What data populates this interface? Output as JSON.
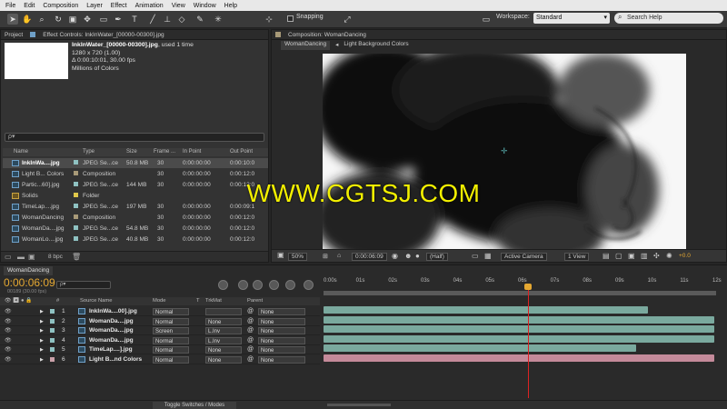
{
  "menu": [
    "File",
    "Edit",
    "Composition",
    "Layer",
    "Effect",
    "Animation",
    "View",
    "Window",
    "Help"
  ],
  "toolbar": {
    "snapping_label": "Snapping",
    "workspace_label": "Workspace:",
    "workspace_value": "Standard",
    "search_placeholder": "Search Help"
  },
  "project": {
    "tab_project": "Project",
    "tab_effect_controls": "Effect Controls: InkInWater_[00000-00300].jpg",
    "info_name": "InkInWater_[00000-00300].jpg",
    "info_used": ", used 1 time",
    "info_dims": "1280 x 720 (1.00)",
    "info_duration": "Δ 0:00:10:01, 30.00 fps",
    "info_colors": "Millions of Colors",
    "search_placeholder": "ρ▾",
    "columns": {
      "name": "Name",
      "type": "Type",
      "size": "Size",
      "frame_rate": "Frame ...",
      "in_point": "In Point",
      "out_point": "Out Point"
    },
    "items": [
      {
        "name": "InkInWa....jpg",
        "type": "JPEG Se...ce",
        "size": "50.8 MB",
        "fps": "30",
        "in": "0:00:00:00",
        "out": "0:00:10:0",
        "color": "#8fc2c2",
        "kind": "footage"
      },
      {
        "name": "Light B... Colors",
        "type": "Composition",
        "size": "",
        "fps": "30",
        "in": "0:00:00:00",
        "out": "0:00:12:0",
        "color": "#a89a78",
        "kind": "comp"
      },
      {
        "name": "Partic...60].jpg",
        "type": "JPEG Se...ce",
        "size": "144 MB",
        "fps": "30",
        "in": "0:00:00:00",
        "out": "0:00:12:0",
        "color": "#8fc2c2",
        "kind": "footage"
      },
      {
        "name": "Solids",
        "type": "Folder",
        "size": "",
        "fps": "",
        "in": "",
        "out": "",
        "color": "#e0c84a",
        "kind": "folder"
      },
      {
        "name": "TimeLap....jpg",
        "type": "JPEG Se...ce",
        "size": "197 MB",
        "fps": "30",
        "in": "0:00:00:00",
        "out": "0:00:09:1",
        "color": "#8fc2c2",
        "kind": "footage"
      },
      {
        "name": "WomanDancing",
        "type": "Composition",
        "size": "",
        "fps": "30",
        "in": "0:00:00:00",
        "out": "0:00:12:0",
        "color": "#a89a78",
        "kind": "comp"
      },
      {
        "name": "WomanDa....jpg",
        "type": "JPEG Se...ce",
        "size": "54.8 MB",
        "fps": "30",
        "in": "0:00:00:00",
        "out": "0:00:12:0",
        "color": "#8fc2c2",
        "kind": "footage"
      },
      {
        "name": "WomanLo....jpg",
        "type": "JPEG Se...ce",
        "size": "40.8 MB",
        "fps": "30",
        "in": "0:00:00:00",
        "out": "0:00:12:0",
        "color": "#8fc2c2",
        "kind": "footage"
      }
    ],
    "bpc": "8 bpc"
  },
  "composition": {
    "panel_title": "Composition: WomanDancing",
    "tab_active": "WomanDancing",
    "tab_other": "Light Background Colors",
    "zoom": "50%",
    "timecode": "0:00:06:09",
    "resolution": "(Half)",
    "camera": "Active Camera",
    "views": "1 View",
    "exposure": "+0.0"
  },
  "watermark": "WWW.CGTSJ.COM",
  "timeline": {
    "tab": "WomanDancing",
    "timecode": "0:00:06:09",
    "timecode_sub": "00189 (30.00 fps)",
    "search_placeholder": "ρ▾",
    "columns": {
      "source_name": "Source Name",
      "mode": "Mode",
      "t": "T",
      "trkmat": "TrkMat",
      "parent": "Parent"
    },
    "ruler": [
      "0:00s",
      "01s",
      "02s",
      "03s",
      "04s",
      "05s",
      "06s",
      "07s",
      "08s",
      "09s",
      "10s",
      "11s",
      "12s"
    ],
    "layers": [
      {
        "num": "1",
        "name": "InkInWa....00].jpg",
        "mode": "Normal",
        "trkmat": "",
        "parent": "None",
        "color": "#8fc2c2",
        "bar_end": 0.83,
        "bar_color": "#7aa99e"
      },
      {
        "num": "2",
        "name": "WomanDa....jpg",
        "mode": "Normal",
        "trkmat": "None",
        "parent": "None",
        "color": "#8fc2c2",
        "bar_end": 1.0,
        "bar_color": "#7aa99e"
      },
      {
        "num": "3",
        "name": "WomanDa....jpg",
        "mode": "Screen",
        "trkmat": "L.Inv",
        "parent": "None",
        "color": "#8fc2c2",
        "bar_end": 1.0,
        "bar_color": "#7aa99e"
      },
      {
        "num": "4",
        "name": "WomanDa....jpg",
        "mode": "Normal",
        "trkmat": "L.Inv",
        "parent": "None",
        "color": "#8fc2c2",
        "bar_end": 1.0,
        "bar_color": "#7aa99e"
      },
      {
        "num": "5",
        "name": "TimeLap....].jpg",
        "mode": "Normal",
        "trkmat": "None",
        "parent": "None",
        "color": "#8fc2c2",
        "bar_end": 0.8,
        "bar_color": "#7aa99e"
      },
      {
        "num": "6",
        "name": "Light B...nd Colors",
        "mode": "Normal",
        "trkmat": "None",
        "parent": "None",
        "color": "#c9a0a8",
        "bar_end": 1.0,
        "bar_color": "#c48a9a"
      }
    ],
    "toggle_label": "Toggle Switches / Modes"
  },
  "colors": {
    "accent": "#e5a832",
    "playhead": "#dd2222",
    "watermark": "#f3f000"
  },
  "playhead_fraction": 0.525
}
